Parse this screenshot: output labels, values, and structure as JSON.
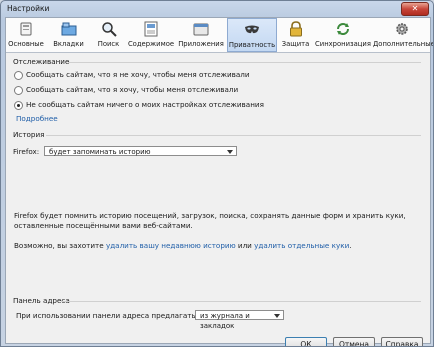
{
  "window": {
    "title": "Настройки",
    "close_symbol": "✕"
  },
  "tabs": [
    {
      "label": "Основные",
      "icon": "window-switch-icon"
    },
    {
      "label": "Вкладки",
      "icon": "tabs-icon"
    },
    {
      "label": "Поиск",
      "icon": "search-icon"
    },
    {
      "label": "Содержимое",
      "icon": "content-icon"
    },
    {
      "label": "Приложения",
      "icon": "applications-icon"
    },
    {
      "label": "Приватность",
      "icon": "privacy-mask-icon"
    },
    {
      "label": "Защита",
      "icon": "lock-icon"
    },
    {
      "label": "Синхронизация",
      "icon": "sync-icon"
    },
    {
      "label": "Дополнительные",
      "icon": "gear-icon"
    }
  ],
  "selected_tab": 5,
  "tracking": {
    "title": "Отслеживание",
    "options": [
      "Сообщать сайтам, что я не хочу, чтобы меня отслеживали",
      "Сообщать сайтам, что я хочу, чтобы меня отслеживали",
      "Не сообщать сайтам ничего о моих настройках отслеживания"
    ],
    "selected": 2,
    "more_link": "Подробнее"
  },
  "history": {
    "title": "История",
    "firefox_label": "Firefox:",
    "select_value": "будет запоминать историю",
    "description": "Firefox будет помнить историю посещений, загрузок, поиска, сохранять данные форм и хранить куки, оставленные посещёнными вами веб-сайтами.",
    "maybe_text": "Возможно, вы захотите",
    "link_clear": "удалить вашу недавнюю историю",
    "or_text": "или",
    "link_cookies": "удалить отдельные куки",
    "end": "."
  },
  "address_bar": {
    "title": "Панель адреса",
    "label": "При использовании панели адреса предлагать ссылки:",
    "select_value": "из журнала и закладок"
  },
  "buttons": {
    "ok": "ОК",
    "cancel": "Отмена",
    "help": "Справка"
  },
  "colors": {
    "accent": "#1f5ea8",
    "selected_tab": "#c3d8f2"
  }
}
